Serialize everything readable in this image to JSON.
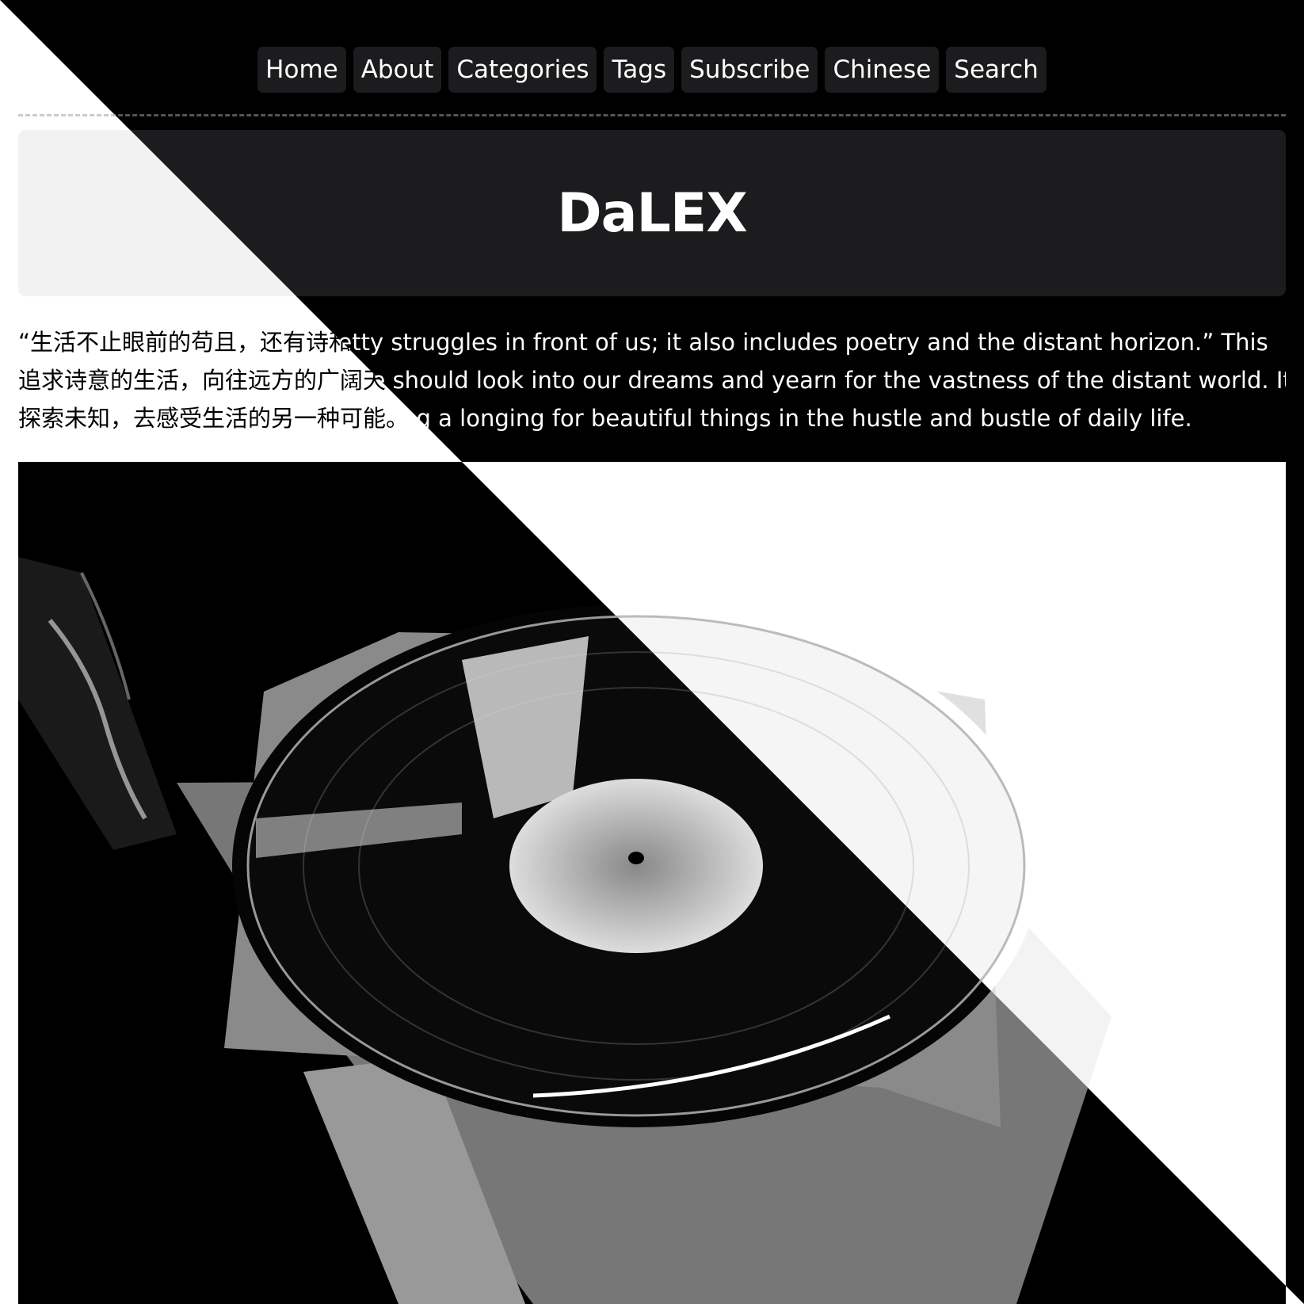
{
  "nav": {
    "items": [
      "Home",
      "About",
      "Categories",
      "Tags",
      "Subscribe",
      "Chinese",
      "Search"
    ]
  },
  "site": {
    "title": "DaLEX"
  },
  "intro": {
    "english_lines": [
      "“Life is not only about the petty struggles in front of us; it also includes poetry and the distant horizon.” This",
      "pursuing a poetic life means we should look into our dreams and yearn for the vastness of the distant world. It encourages",
      "exploring the unknown and keeping a longing for beautiful things in the hustle and bustle of daily life."
    ],
    "chinese_lines": [
      "“生活不止眼前的苟且，还有诗和远方的田野。”",
      "追求诗意的生活，向往远方的广阔天地，",
      "探索未知，去感受生活的另一种可能。"
    ]
  },
  "colors": {
    "dark_bg": "#000000",
    "dark_panel": "#1c1c1e",
    "light_bg": "#ffffff",
    "light_panel": "#f2f2f2"
  },
  "photo": {
    "subject": "vinyl-record-on-sleeve"
  }
}
